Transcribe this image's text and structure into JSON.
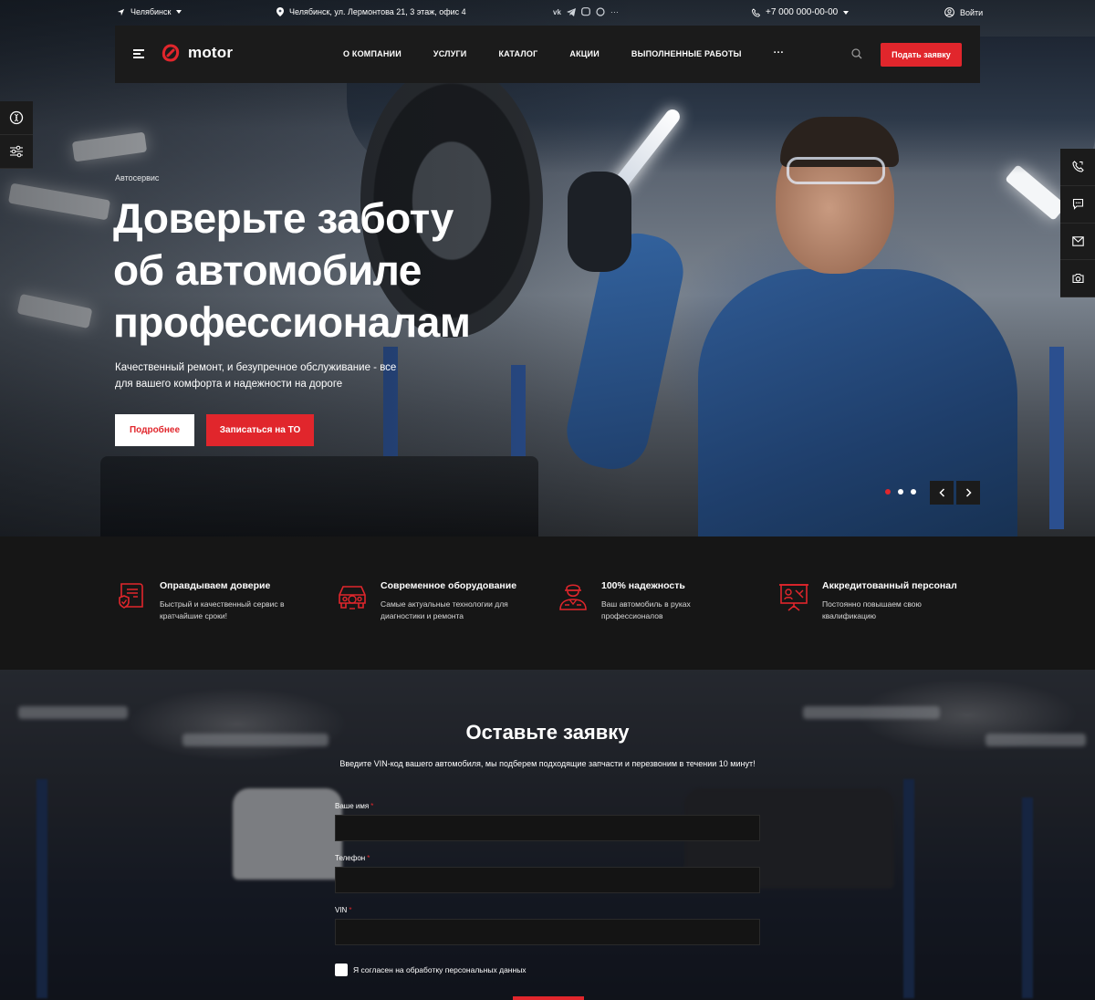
{
  "topbar": {
    "city": "Челябинск",
    "address": "Челябинск, ул. Лермонтова 21, 3 этаж, офис 4",
    "social_icons": [
      "vk-icon",
      "telegram-icon",
      "viber-icon",
      "whatsapp-icon",
      "more-icon"
    ],
    "more_label": "···",
    "phone": "+7 000 000-00-00",
    "login": "Войти"
  },
  "nav": {
    "logo_text": "motor",
    "menu": [
      "О компании",
      "Услуги",
      "Каталог",
      "Акции",
      "Выполненные работы"
    ],
    "more_label": "···",
    "cta": "Подать заявку"
  },
  "hero": {
    "eyebrow": "Автосервис",
    "title_lines": [
      "Доверьте заботу",
      "об автомобиле",
      "профессионалам"
    ],
    "subtitle": "Качественный ремонт, и безупречное обслуживание - все для вашего комфорта и надежности на дороге",
    "button_more": "Подробнее",
    "button_signup": "Записаться на ТО",
    "slides_total": 3,
    "active_slide": 1
  },
  "features": [
    {
      "icon": "certificate-icon",
      "title": "Оправдываем доверие",
      "desc": "Быстрый и качественный сервис в кратчайшие сроки!"
    },
    {
      "icon": "car-diagnostics-icon",
      "title": "Современное оборудование",
      "desc": "Самые актуальные технологии для диагностики и ремонта"
    },
    {
      "icon": "mechanic-icon",
      "title": "100% надежность",
      "desc": "Ваш автомобиль в руках профессионалов"
    },
    {
      "icon": "presentation-board-icon",
      "title": "Аккредитованный персонал",
      "desc": "Постоянно повышаем свою квалификацию"
    }
  ],
  "form": {
    "title": "Оставьте заявку",
    "subtitle": "Введите VIN-код вашего автомобиля, мы подберем подходящие запчасти и перезвоним в течении 10 минут!",
    "fields": [
      {
        "label": "Ваше имя",
        "required": "*",
        "value": ""
      },
      {
        "label": "Телефон",
        "required": "*",
        "value": ""
      },
      {
        "label": "VIN",
        "required": "*",
        "value": ""
      }
    ],
    "consent": "Я согласен на обработку персональных данных"
  },
  "colors": {
    "accent": "#e1262c",
    "panel": "#1b1b1b",
    "background": "#161616"
  }
}
